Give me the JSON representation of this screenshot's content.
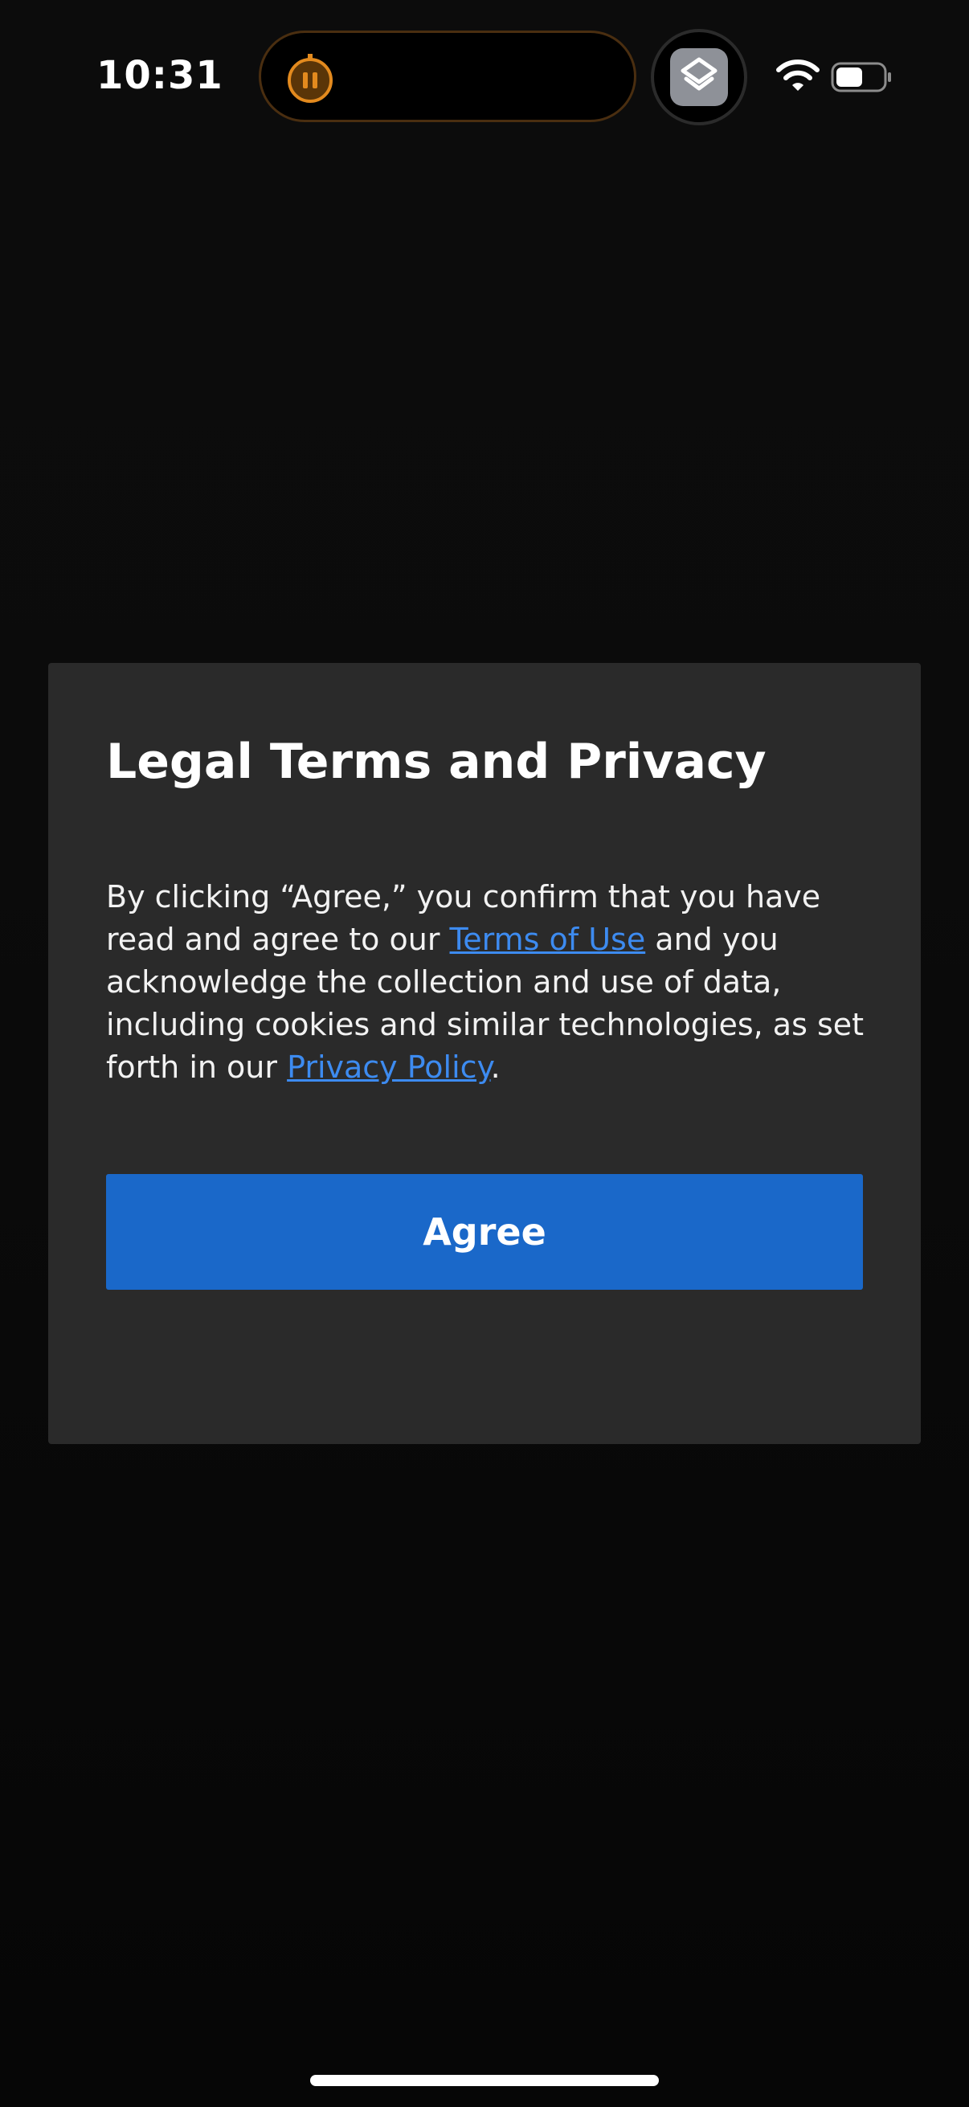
{
  "status_bar": {
    "time": "10:31",
    "icons": [
      "timer-icon",
      "shortcuts-icon",
      "wifi-icon",
      "battery-icon"
    ]
  },
  "dialog": {
    "title": "Legal Terms and Privacy",
    "body_part1": "By clicking “Agree,” you confirm that you have read and agree to our ",
    "terms_link": "Terms of Use",
    "body_part2": " and you acknowledge the collection and use of data, including cookies and similar technologies, as set forth in our ",
    "privacy_link": "Privacy Policy",
    "body_part3": ".",
    "agree_label": "Agree"
  },
  "colors": {
    "background": "#0a0a0a",
    "dialog": "#2a2a2a",
    "button": "#1a68c9",
    "link": "#3d8bf0",
    "timer_accent": "#e38a1e"
  }
}
